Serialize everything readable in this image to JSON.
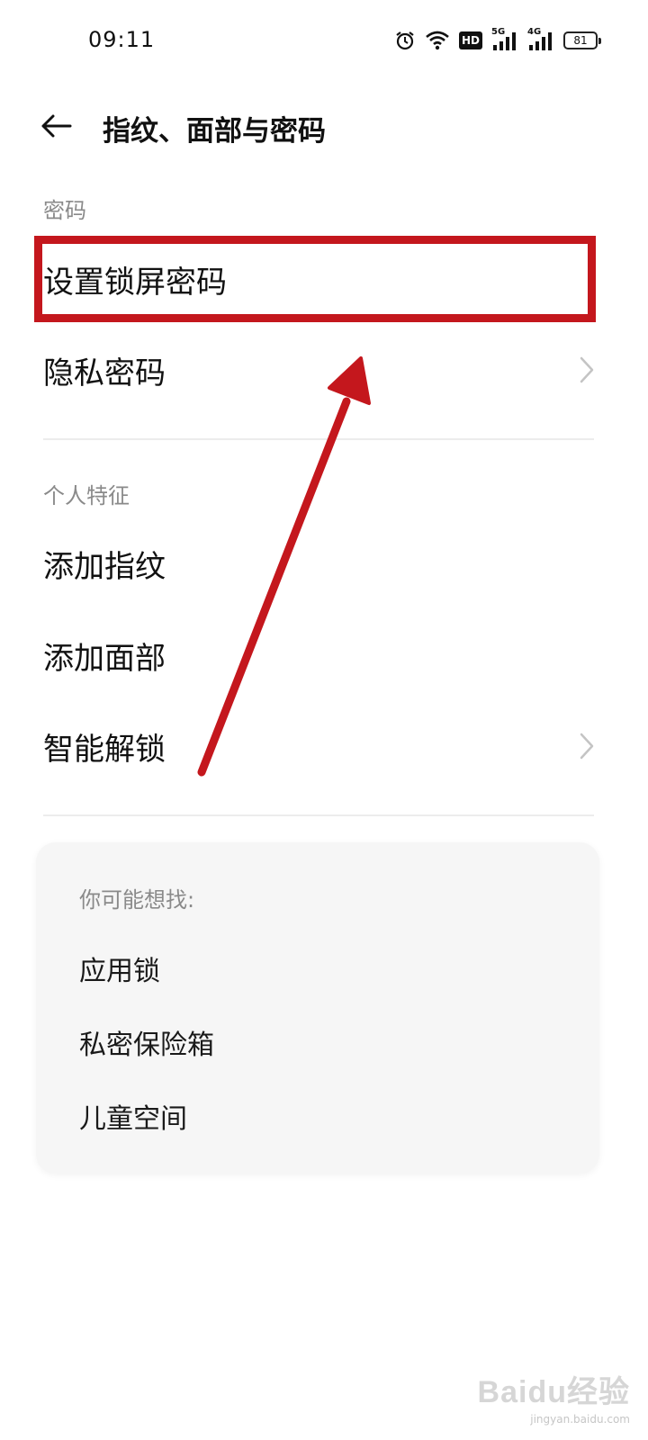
{
  "status_bar": {
    "time": "09:11",
    "network_1": "5G",
    "network_2": "4G",
    "hd_badge": "HD",
    "battery": "81",
    "icons": [
      "alarm-icon",
      "wifi-icon",
      "hd-icon",
      "signal-5g-icon",
      "signal-4g-icon",
      "battery-icon"
    ]
  },
  "header": {
    "title": "指纹、面部与密码"
  },
  "sections": {
    "password": {
      "header": "密码",
      "items": [
        {
          "label": "设置锁屏密码"
        },
        {
          "label": "隐私密码"
        }
      ]
    },
    "biometrics": {
      "header": "个人特征",
      "items": [
        {
          "label": "添加指纹"
        },
        {
          "label": "添加面部"
        },
        {
          "label": "智能解锁"
        }
      ]
    }
  },
  "suggestions": {
    "title": "你可能想找:",
    "items": [
      "应用锁",
      "私密保险箱",
      "儿童空间"
    ]
  },
  "annotation": {
    "color": "#c4171d"
  },
  "watermark": {
    "logo": "Baidu经验",
    "sub": "jingyan.baidu.com"
  }
}
